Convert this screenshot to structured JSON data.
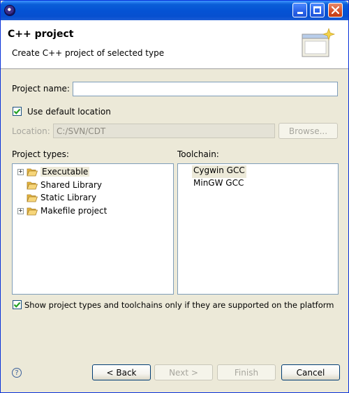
{
  "window": {
    "title": "",
    "controls": [
      "minimize",
      "maximize",
      "close"
    ]
  },
  "header": {
    "title": "C++ project",
    "description": "Create C++ project of selected type",
    "graphic_icon": "wizard-banner-icon"
  },
  "form": {
    "project_name_label": "Project name:",
    "project_name_value": "",
    "use_default_location_label": "Use default location",
    "use_default_location_checked": true,
    "location_label": "Location:",
    "location_value": "C:/SVN/CDT",
    "browse_label": "Browse..."
  },
  "project_types": {
    "label": "Project types:",
    "items": [
      {
        "label": "Executable",
        "expandable": true,
        "selected": true
      },
      {
        "label": "Shared Library",
        "expandable": false,
        "selected": false
      },
      {
        "label": "Static Library",
        "expandable": false,
        "selected": false
      },
      {
        "label": "Makefile project",
        "expandable": true,
        "selected": false
      }
    ]
  },
  "toolchain": {
    "label": "Toolchain:",
    "items": [
      {
        "label": "Cygwin GCC",
        "selected": true
      },
      {
        "label": "MinGW GCC",
        "selected": false
      }
    ]
  },
  "filter": {
    "label": "Show project types and toolchains only if they are supported on the platform",
    "checked": true
  },
  "footer": {
    "help_icon": "help-icon",
    "back_label": "< Back",
    "next_label": "Next >",
    "finish_label": "Finish",
    "cancel_label": "Cancel"
  },
  "colors": {
    "titlebar": "#0553d4",
    "dialog_bg": "#ece9d8",
    "checkmark": "#21a121",
    "folder": "#e8b73d"
  }
}
